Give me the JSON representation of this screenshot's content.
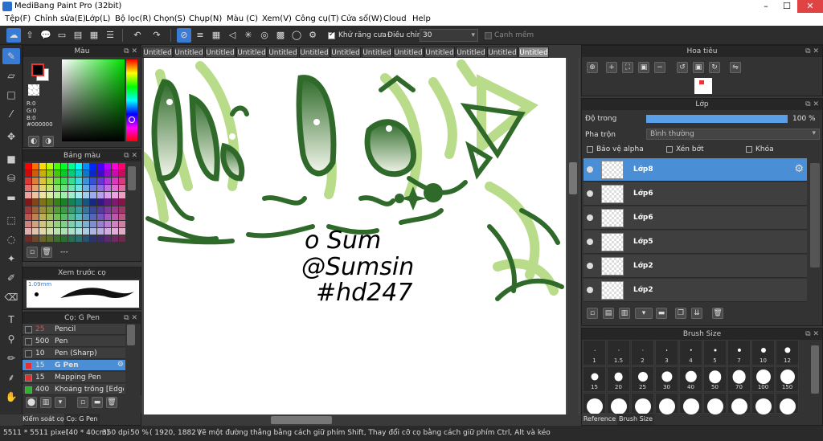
{
  "window": {
    "title": "MediBang Paint Pro (32bit)"
  },
  "menu": [
    "Tệp(F)",
    "Chỉnh sửa(E)",
    "Lớp(L)",
    "Bộ lọc(R)",
    "Chọn(S)",
    "Chụp(N)",
    "Màu (C)",
    "Xem(V)",
    "Công cụ(T)",
    "Cửa sổ(W)",
    "Cloud",
    "Help"
  ],
  "toolbar": {
    "antialias_label": "Khử răng cưa",
    "adjust_label": "Điều chỉnh",
    "adjust_value": "30",
    "edge_label": "Cạnh mềm"
  },
  "color_panel": {
    "title": "Màu",
    "r": "R:0",
    "g": "G:0",
    "b": "B:0",
    "hex": "#000000",
    "fg": "#000000",
    "bg": "#ffffff"
  },
  "palette_panel": {
    "title": "Bảng màu",
    "footer": "---"
  },
  "preview_panel": {
    "title": "Xem trước cọ",
    "size": "1.09mm"
  },
  "brush_panel": {
    "title": "Cọ: G Pen",
    "items": [
      {
        "size": "25",
        "name": "Pencil",
        "color": "#333333"
      },
      {
        "size": "500",
        "name": "Pen",
        "color": "#333333"
      },
      {
        "size": "10",
        "name": "Pen (Sharp)",
        "color": "#333333"
      },
      {
        "size": "15",
        "name": "G Pen",
        "color": "#e03030"
      },
      {
        "size": "15",
        "name": "Mapping Pen",
        "color": "#e03030"
      },
      {
        "size": "400",
        "name": "Khoảng trống [Edge]",
        "color": "#30b030"
      }
    ],
    "bottom_tabs": [
      "Kiểm soát cọ",
      "Cọ: G Pen"
    ]
  },
  "tabs": [
    "Untitled",
    "Untitled",
    "Untitled",
    "Untitled",
    "Untitled",
    "Untitled",
    "Untitled",
    "Untitled",
    "Untitled",
    "Untitled",
    "Untitled",
    "Untitled",
    "Untitled"
  ],
  "canvas": {
    "line1": "o Sum",
    "line2": "@Sumsin",
    "line3": "#hd247"
  },
  "navigator": {
    "title": "Hoa tiêu"
  },
  "layer_panel": {
    "title": "Lớp",
    "opacity_label": "Độ trong",
    "opacity_value": "100 %",
    "opacity_fraction": 1.0,
    "blend_label": "Pha trộn",
    "blend_value": "Bình thường",
    "protect_alpha": "Bảo vệ alpha",
    "clipping": "Xén bớt",
    "lock": "Khóa",
    "layers": [
      "Lớp8",
      "Lớp6",
      "Lớp6",
      "Lớp5",
      "Lớp2",
      "Lớp2"
    ]
  },
  "brush_size_panel": {
    "title": "Brush Size",
    "row1": [
      "1",
      "1.5",
      "2",
      "3",
      "4",
      "5",
      "7",
      "10",
      "12"
    ],
    "row2": [
      "15",
      "20",
      "25",
      "30",
      "40",
      "50",
      "70",
      "100",
      "150"
    ],
    "bottom_tabs": [
      "Reference",
      "Brush Size"
    ]
  },
  "status": {
    "size": "5511 * 5511 pixel",
    "dim": "(40 * 40cm)",
    "dpi": "350 dpi",
    "zoom": "50 %",
    "coords": "( 1920, 1882 )",
    "hint": "Vẽ một đường thẳng bằng cách giữ phím Shift, Thay đổi cỡ cọ bằng cách giữ phím Ctrl, Alt và kéo"
  }
}
